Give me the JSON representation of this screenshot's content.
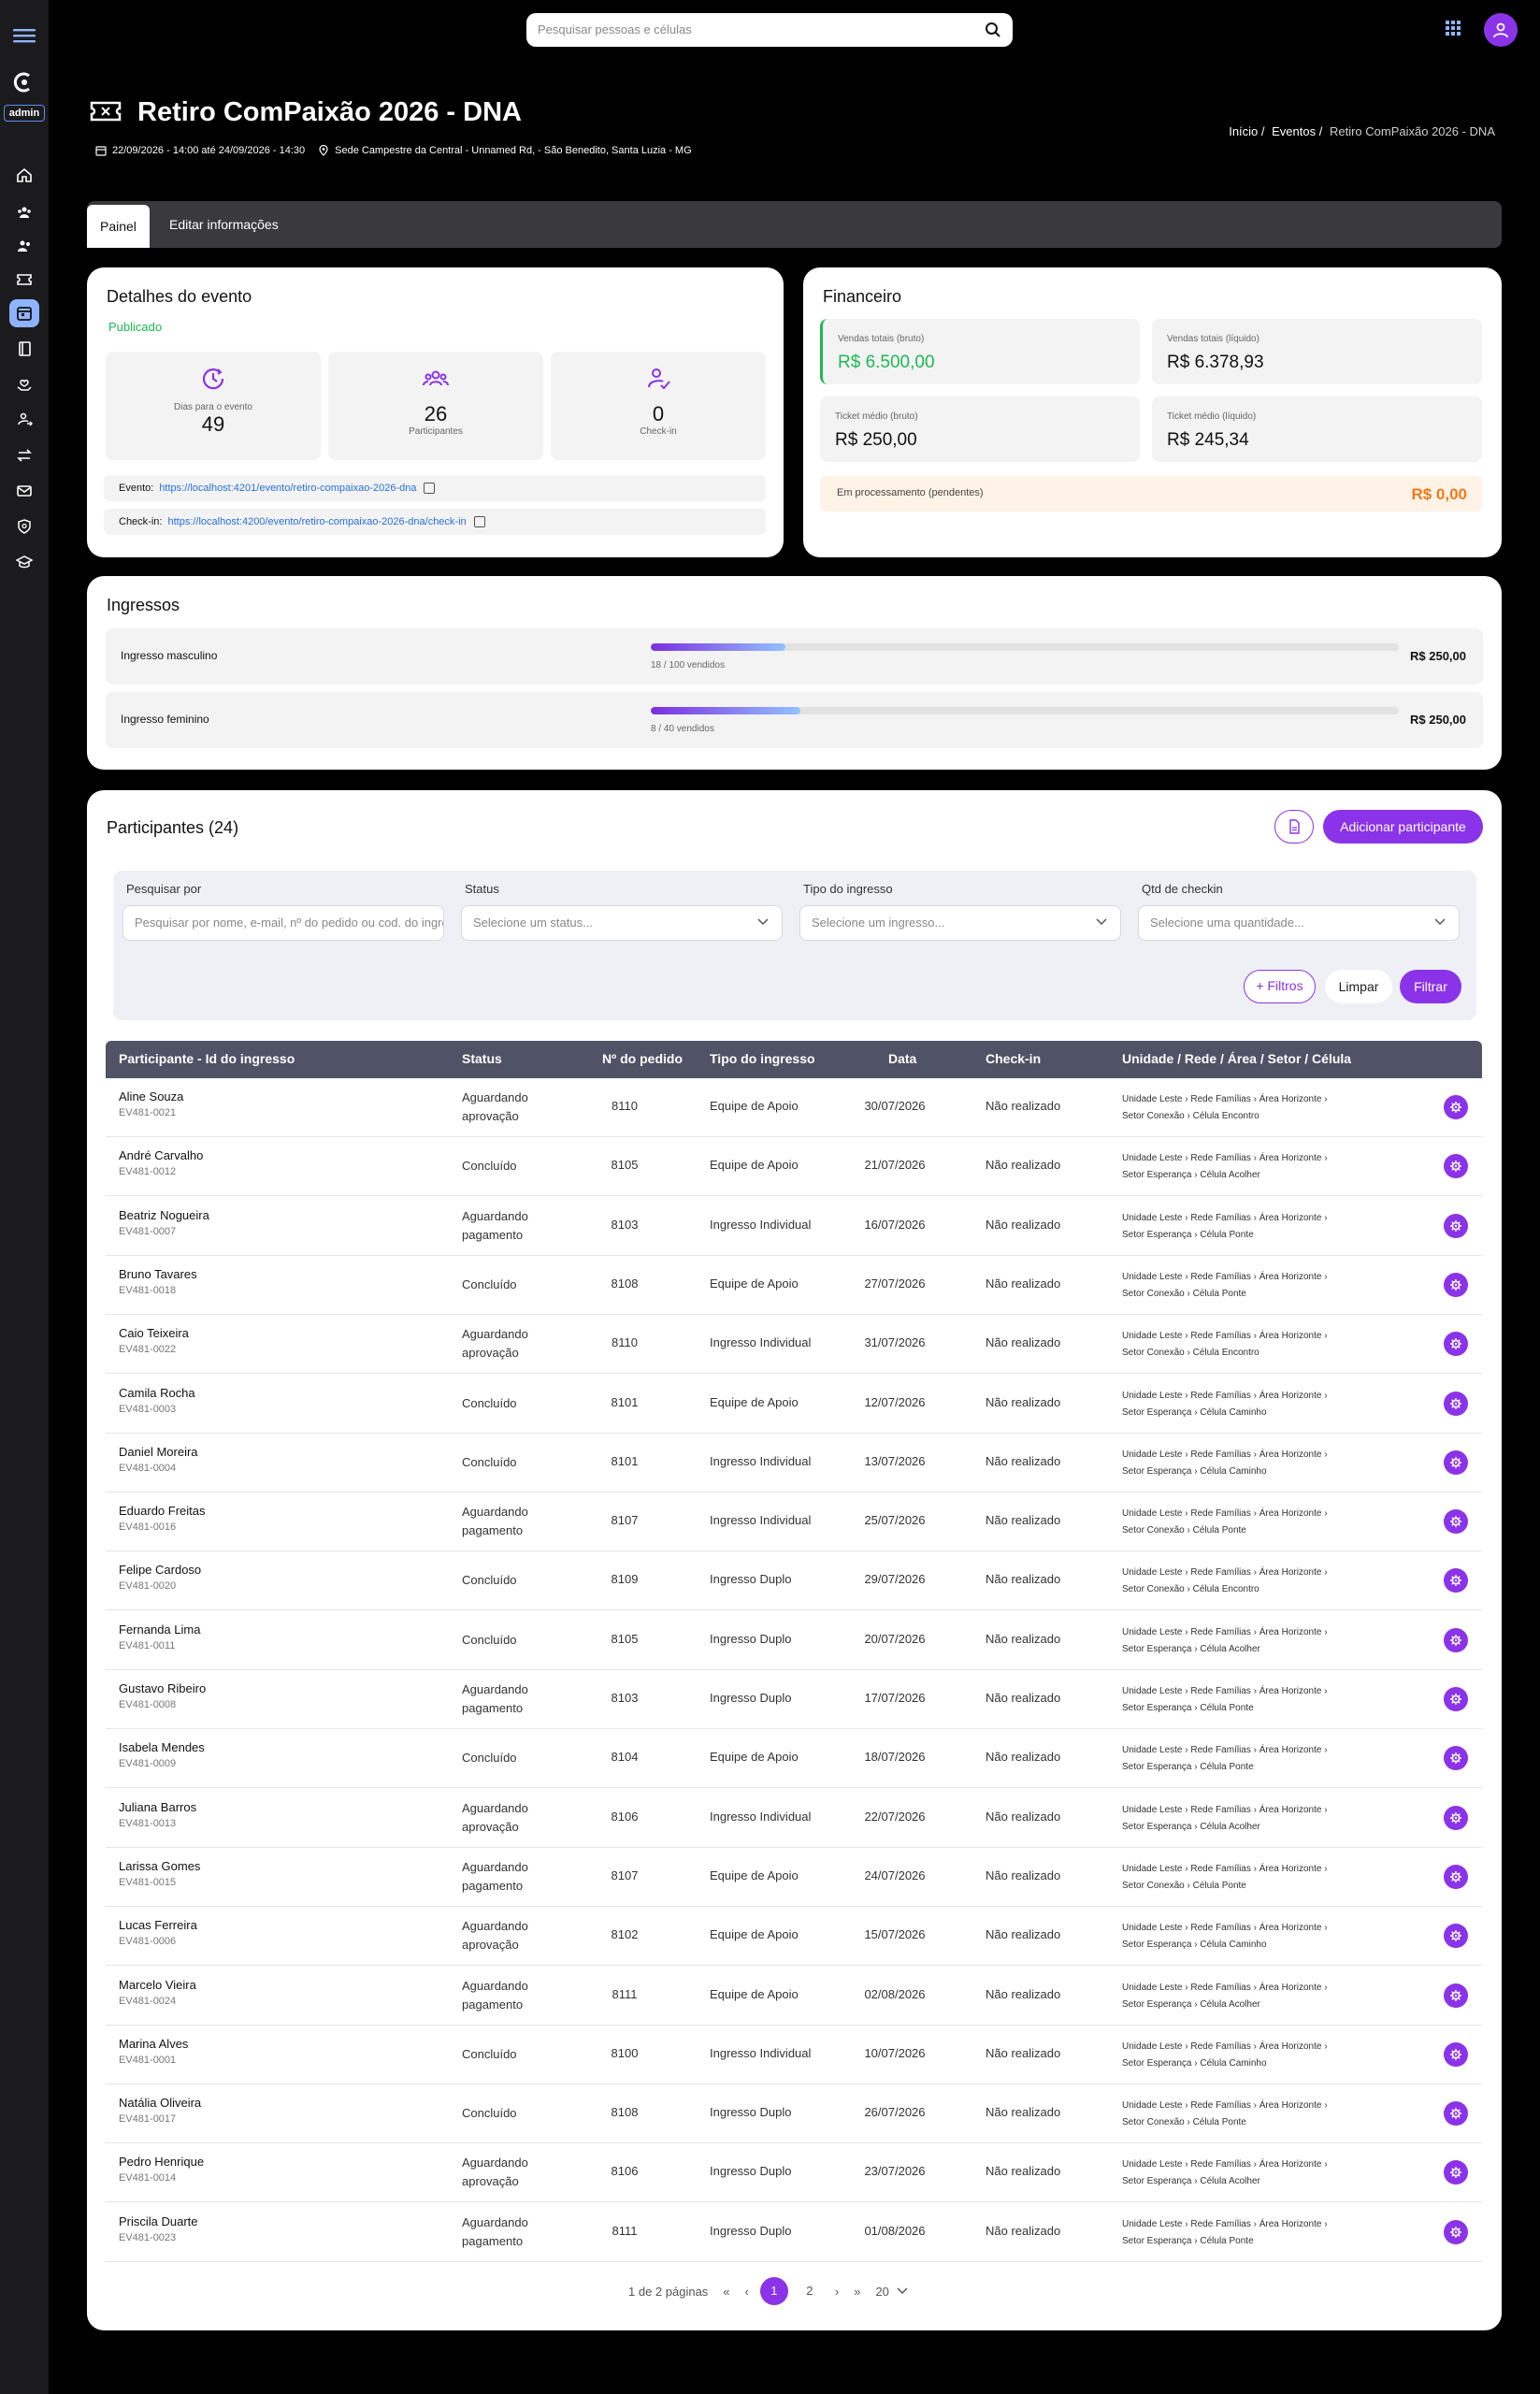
{
  "sidebar": {
    "admin_label": "admin",
    "items": [
      "home-icon",
      "users-group-icon",
      "users-icon",
      "ticket-icon",
      "calendar-icon",
      "book-icon",
      "hands-heart-icon",
      "user-arrow-icon",
      "transfer-icon",
      "mail-icon",
      "shield-search-icon",
      "graduation-cap-icon"
    ],
    "active_index": 4
  },
  "topbar": {
    "search_placeholder": "Pesquisar pessoas e células"
  },
  "event": {
    "title": "Retiro ComPaixão 2026 - DNA",
    "datetime": "22/09/2026 - 14:00 até 24/09/2026 - 14:30",
    "location": "Sede Campestre da Central - Unnamed Rd, - São Benedito, Santa Luzia - MG"
  },
  "breadcrumb": {
    "items": [
      "Início /",
      "Eventos /",
      "Retiro ComPaixão 2026 - DNA"
    ]
  },
  "tabs": [
    "Painel",
    "Editar informações"
  ],
  "details": {
    "title": "Detalhes do evento",
    "status": "Publicado",
    "stats": [
      {
        "label": "Dias para o evento",
        "value": "49",
        "icon": "calendar-clock-icon"
      },
      {
        "label": "Participantes",
        "value": "26",
        "icon": "users-group-icon"
      },
      {
        "label": "Check-in",
        "value": "0",
        "icon": "user-check-icon"
      }
    ],
    "event_link_label": "Evento:",
    "event_link": "https://localhost:4201/evento/retiro-compaixao-2026-dna",
    "checkin_link_label": "Check-in:",
    "checkin_link": "https://localhost:4200/evento/retiro-compaixao-2026-dna/check-in"
  },
  "finance": {
    "title": "Financeiro",
    "boxes": [
      {
        "label": "Vendas totais (bruto)",
        "value": "R$ 6.500,00"
      },
      {
        "label": "Vendas totais (líquido)",
        "value": "R$ 6.378,93"
      },
      {
        "label": "Ticket médio (bruto)",
        "value": "R$ 250,00"
      },
      {
        "label": "Ticket médio (líquido)",
        "value": "R$ 245,34"
      }
    ],
    "pending_label": "Em processamento (pendentes)",
    "pending_value": "R$ 0,00",
    "colors": {
      "positive": "#1eb854",
      "pending": "#f07a1a"
    }
  },
  "tickets": {
    "title": "Ingressos",
    "items": [
      {
        "name": "Ingresso masculino",
        "sold_text": "18 / 100 vendidos",
        "sold": 18,
        "total": 100,
        "price": "R$ 250,00"
      },
      {
        "name": "Ingresso feminino",
        "sold_text": "8 / 40 vendidos",
        "sold": 8,
        "total": 40,
        "price": "R$ 250,00"
      }
    ]
  },
  "participants": {
    "title": "Participantes (24)",
    "add_label": "Adicionar participante",
    "filters": {
      "search_label": "Pesquisar por",
      "search_placeholder": "Pesquisar por nome, e-mail, nº do pedido ou cod. do ingresso",
      "status_label": "Status",
      "status_placeholder": "Selecione um status...",
      "type_label": "Tipo do ingresso",
      "type_placeholder": "Selecione um ingresso...",
      "qty_label": "Qtd de checkin",
      "qty_placeholder": "Selecione uma quantidade...",
      "more_label": "+ Filtros",
      "clear_label": "Limpar",
      "apply_label": "Filtrar"
    },
    "columns": [
      "Participante - Id do ingresso",
      "Status",
      "Nº do pedido",
      "Tipo do ingresso",
      "Data",
      "Check-in",
      "Unidade / Rede / Área / Setor / Célula"
    ],
    "rows": [
      {
        "name": "Aline Souza",
        "id": "EV481-0021",
        "status": "Aguardando aprovação",
        "order": "8110",
        "type": "Equipe de Apoio",
        "date": "30/07/2026",
        "checkin": "Não realizado",
        "org1": "Unidade Leste › Rede Famílias › Área Horizonte ›",
        "org2": "Setor Conexão › Célula Encontro"
      },
      {
        "name": "André Carvalho",
        "id": "EV481-0012",
        "status": "Concluído",
        "order": "8105",
        "type": "Equipe de Apoio",
        "date": "21/07/2026",
        "checkin": "Não realizado",
        "org1": "Unidade Leste › Rede Famílias › Área Horizonte ›",
        "org2": "Setor Esperança › Célula Acolher"
      },
      {
        "name": "Beatriz Nogueira",
        "id": "EV481-0007",
        "status": "Aguardando pagamento",
        "order": "8103",
        "type": "Ingresso Individual",
        "date": "16/07/2026",
        "checkin": "Não realizado",
        "org1": "Unidade Leste › Rede Famílias › Área Horizonte ›",
        "org2": "Setor Esperança › Célula Ponte"
      },
      {
        "name": "Bruno Tavares",
        "id": "EV481-0018",
        "status": "Concluído",
        "order": "8108",
        "type": "Equipe de Apoio",
        "date": "27/07/2026",
        "checkin": "Não realizado",
        "org1": "Unidade Leste › Rede Famílias › Área Horizonte ›",
        "org2": "Setor Conexão › Célula Ponte"
      },
      {
        "name": "Caio Teixeira",
        "id": "EV481-0022",
        "status": "Aguardando aprovação",
        "order": "8110",
        "type": "Ingresso Individual",
        "date": "31/07/2026",
        "checkin": "Não realizado",
        "org1": "Unidade Leste › Rede Famílias › Área Horizonte ›",
        "org2": "Setor Conexão › Célula Encontro"
      },
      {
        "name": "Camila Rocha",
        "id": "EV481-0003",
        "status": "Concluído",
        "order": "8101",
        "type": "Equipe de Apoio",
        "date": "12/07/2026",
        "checkin": "Não realizado",
        "org1": "Unidade Leste › Rede Famílias › Área Horizonte ›",
        "org2": "Setor Esperança › Célula Caminho"
      },
      {
        "name": "Daniel Moreira",
        "id": "EV481-0004",
        "status": "Concluído",
        "order": "8101",
        "type": "Ingresso Individual",
        "date": "13/07/2026",
        "checkin": "Não realizado",
        "org1": "Unidade Leste › Rede Famílias › Área Horizonte ›",
        "org2": "Setor Esperança › Célula Caminho"
      },
      {
        "name": "Eduardo Freitas",
        "id": "EV481-0016",
        "status": "Aguardando pagamento",
        "order": "8107",
        "type": "Ingresso Individual",
        "date": "25/07/2026",
        "checkin": "Não realizado",
        "org1": "Unidade Leste › Rede Famílias › Área Horizonte ›",
        "org2": "Setor Conexão › Célula Ponte"
      },
      {
        "name": "Felipe Cardoso",
        "id": "EV481-0020",
        "status": "Concluído",
        "order": "8109",
        "type": "Ingresso Duplo",
        "date": "29/07/2026",
        "checkin": "Não realizado",
        "org1": "Unidade Leste › Rede Famílias › Área Horizonte ›",
        "org2": "Setor Conexão › Célula Encontro"
      },
      {
        "name": "Fernanda Lima",
        "id": "EV481-0011",
        "status": "Concluído",
        "order": "8105",
        "type": "Ingresso Duplo",
        "date": "20/07/2026",
        "checkin": "Não realizado",
        "org1": "Unidade Leste › Rede Famílias › Área Horizonte ›",
        "org2": "Setor Esperança › Célula Acolher"
      },
      {
        "name": "Gustavo Ribeiro",
        "id": "EV481-0008",
        "status": "Aguardando pagamento",
        "order": "8103",
        "type": "Ingresso Duplo",
        "date": "17/07/2026",
        "checkin": "Não realizado",
        "org1": "Unidade Leste › Rede Famílias › Área Horizonte ›",
        "org2": "Setor Esperança › Célula Ponte"
      },
      {
        "name": "Isabela Mendes",
        "id": "EV481-0009",
        "status": "Concluído",
        "order": "8104",
        "type": "Equipe de Apoio",
        "date": "18/07/2026",
        "checkin": "Não realizado",
        "org1": "Unidade Leste › Rede Famílias › Área Horizonte ›",
        "org2": "Setor Esperança › Célula Ponte"
      },
      {
        "name": "Juliana Barros",
        "id": "EV481-0013",
        "status": "Aguardando aprovação",
        "order": "8106",
        "type": "Ingresso Individual",
        "date": "22/07/2026",
        "checkin": "Não realizado",
        "org1": "Unidade Leste › Rede Famílias › Área Horizonte ›",
        "org2": "Setor Esperança › Célula Acolher"
      },
      {
        "name": "Larissa Gomes",
        "id": "EV481-0015",
        "status": "Aguardando pagamento",
        "order": "8107",
        "type": "Equipe de Apoio",
        "date": "24/07/2026",
        "checkin": "Não realizado",
        "org1": "Unidade Leste › Rede Famílias › Área Horizonte ›",
        "org2": "Setor Conexão › Célula Ponte"
      },
      {
        "name": "Lucas Ferreira",
        "id": "EV481-0006",
        "status": "Aguardando aprovação",
        "order": "8102",
        "type": "Equipe de Apoio",
        "date": "15/07/2026",
        "checkin": "Não realizado",
        "org1": "Unidade Leste › Rede Famílias › Área Horizonte ›",
        "org2": "Setor Esperança › Célula Caminho"
      },
      {
        "name": "Marcelo Vieira",
        "id": "EV481-0024",
        "status": "Aguardando pagamento",
        "order": "8111",
        "type": "Equipe de Apoio",
        "date": "02/08/2026",
        "checkin": "Não realizado",
        "org1": "Unidade Leste › Rede Famílias › Área Horizonte ›",
        "org2": "Setor Esperança › Célula Acolher"
      },
      {
        "name": "Marina Alves",
        "id": "EV481-0001",
        "status": "Concluído",
        "order": "8100",
        "type": "Ingresso Individual",
        "date": "10/07/2026",
        "checkin": "Não realizado",
        "org1": "Unidade Leste › Rede Famílias › Área Horizonte ›",
        "org2": "Setor Esperança › Célula Caminho"
      },
      {
        "name": "Natália Oliveira",
        "id": "EV481-0017",
        "status": "Concluído",
        "order": "8108",
        "type": "Ingresso Duplo",
        "date": "26/07/2026",
        "checkin": "Não realizado",
        "org1": "Unidade Leste › Rede Famílias › Área Horizonte ›",
        "org2": "Setor Conexão › Célula Ponte"
      },
      {
        "name": "Pedro Henrique",
        "id": "EV481-0014",
        "status": "Aguardando aprovação",
        "order": "8106",
        "type": "Ingresso Duplo",
        "date": "23/07/2026",
        "checkin": "Não realizado",
        "org1": "Unidade Leste › Rede Famílias › Área Horizonte ›",
        "org2": "Setor Esperança › Célula Acolher"
      },
      {
        "name": "Priscila Duarte",
        "id": "EV481-0023",
        "status": "Aguardando pagamento",
        "order": "8111",
        "type": "Ingresso Duplo",
        "date": "01/08/2026",
        "checkin": "Não realizado",
        "org1": "Unidade Leste › Rede Famílias › Área Horizonte ›",
        "org2": "Setor Esperança › Célula Ponte"
      }
    ],
    "pagination": {
      "info": "1 de 2 páginas",
      "first": "«",
      "prev": "‹",
      "pages": [
        "1",
        "2"
      ],
      "current": "1",
      "next": "›",
      "last": "»",
      "page_size": "20"
    }
  },
  "colors": {
    "accent": "#8a33e8",
    "header_bg": "#505366",
    "sidebar_active": "#8fb4ff"
  }
}
